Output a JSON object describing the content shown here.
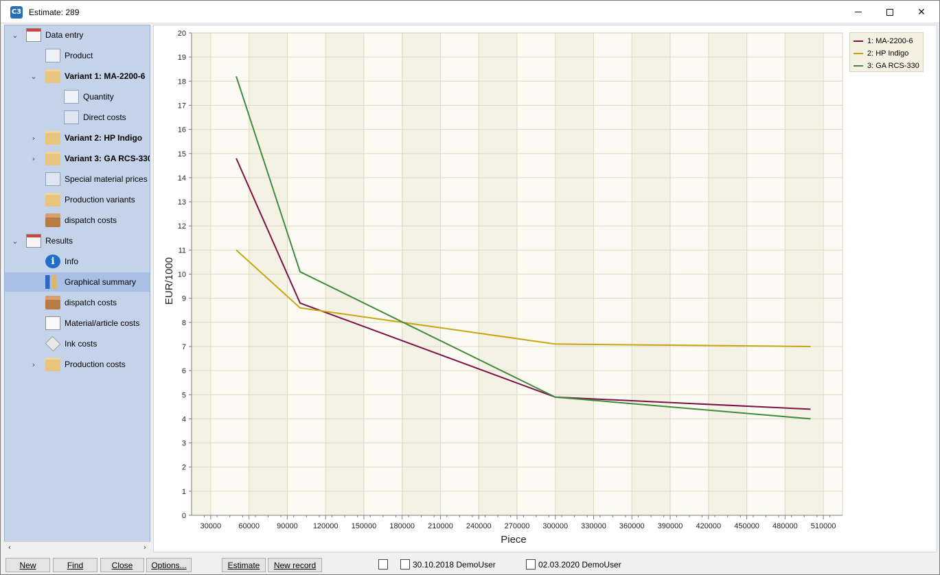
{
  "window": {
    "title": "Estimate: 289",
    "app_icon_text": "C3",
    "controls": {
      "minimize": "minimize-icon",
      "maximize": "maximize-icon",
      "close": "close-icon"
    }
  },
  "sidebar": {
    "items": [
      {
        "label": "Data entry",
        "chevron": "⌄",
        "icon": "window-icon",
        "bold": false
      },
      {
        "label": "Product",
        "icon": "product-icon",
        "bold": false
      },
      {
        "label": "Variant 1: MA-2200-6",
        "chevron": "⌄",
        "icon": "folder-icon",
        "bold": true
      },
      {
        "label": "Quantity",
        "icon": "quantity-icon",
        "bold": false
      },
      {
        "label": "Direct costs",
        "icon": "calculator-icon",
        "bold": false
      },
      {
        "label": "Variant 2: HP Indigo",
        "chevron": "›",
        "icon": "folder-icon",
        "bold": true
      },
      {
        "label": "Variant 3: GA RCS-330",
        "chevron": "›",
        "icon": "folder-icon",
        "bold": true
      },
      {
        "label": "Special material prices",
        "icon": "calculator-icon",
        "bold": false
      },
      {
        "label": "Production variants",
        "icon": "folders-icon",
        "bold": false
      },
      {
        "label": "dispatch costs",
        "icon": "box-icon",
        "bold": false
      },
      {
        "label": "Results",
        "chevron": "⌄",
        "icon": "window-icon",
        "bold": false
      },
      {
        "label": "Info",
        "icon": "info-icon",
        "bold": false
      },
      {
        "label": "Graphical summary",
        "icon": "chart-icon",
        "bold": false,
        "selected": true
      },
      {
        "label": "dispatch costs",
        "icon": "box-icon",
        "bold": false
      },
      {
        "label": "Material/article costs",
        "icon": "document-icon",
        "bold": false
      },
      {
        "label": "Ink costs",
        "icon": "ink-icon",
        "bold": false
      },
      {
        "label": "Production costs",
        "chevron": "›",
        "icon": "folder-icon",
        "bold": false
      }
    ]
  },
  "colors": {
    "series1": "#7b1145",
    "series2": "#c9a414",
    "series3": "#3f8a3b",
    "plot_bg": "#f4f2e4",
    "grid": "#dcd9c2"
  },
  "chart_data": {
    "type": "line",
    "xlabel": "Piece",
    "ylabel": "EUR/1000",
    "xlim": [
      15000,
      525000
    ],
    "ylim": [
      0,
      20
    ],
    "xticks": [
      30000,
      60000,
      90000,
      120000,
      150000,
      180000,
      210000,
      240000,
      270000,
      300000,
      330000,
      360000,
      390000,
      420000,
      450000,
      480000,
      510000
    ],
    "yticks": [
      0,
      1,
      2,
      3,
      4,
      5,
      6,
      7,
      8,
      9,
      10,
      11,
      12,
      13,
      14,
      15,
      16,
      17,
      18,
      19,
      20
    ],
    "grid": true,
    "legend": "top-right",
    "x": [
      50000,
      100000,
      300000,
      500000
    ],
    "series": [
      {
        "name": "1: MA-2200-6",
        "values": [
          14.8,
          8.8,
          4.9,
          4.4
        ]
      },
      {
        "name": "2: HP Indigo",
        "values": [
          11.0,
          8.6,
          7.1,
          7.0
        ]
      },
      {
        "name": "3: GA RCS-330",
        "values": [
          18.2,
          10.1,
          4.9,
          4.0
        ]
      }
    ]
  },
  "statusbar": {
    "buttons": [
      "New",
      "Find",
      "Close",
      "Options...",
      "Estimate",
      "New record"
    ],
    "created": "30.10.2018 DemoUser",
    "modified": "02.03.2020 DemoUser"
  }
}
